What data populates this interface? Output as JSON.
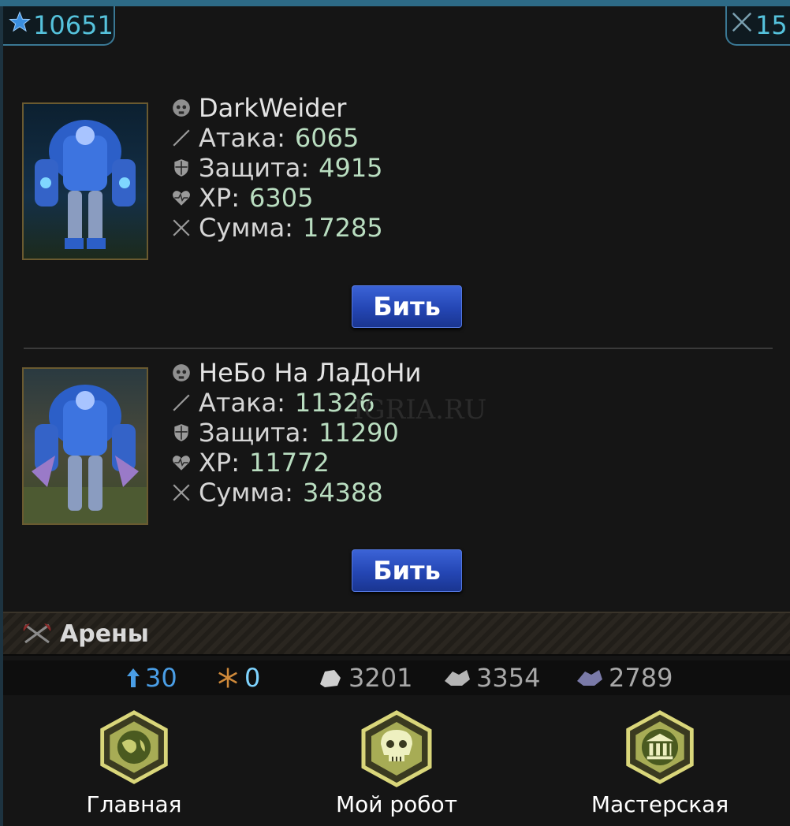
{
  "header": {
    "rating_value": "10651",
    "battles_value": "15"
  },
  "opponents": [
    {
      "name": "DarkWeider",
      "attack_label": "Атака:",
      "attack": "6065",
      "defense_label": "Защита:",
      "defense": "4915",
      "hp_label": "ХР:",
      "hp": "6305",
      "total_label": "Сумма:",
      "total": "17285",
      "button": "Бить"
    },
    {
      "name": "НеБо На ЛаДоНи",
      "attack_label": "Атака:",
      "attack": "11326",
      "defense_label": "Защита:",
      "defense": "11290",
      "hp_label": "ХР:",
      "hp": "11772",
      "total_label": "Сумма:",
      "total": "34388",
      "button": "Бить"
    }
  ],
  "watermark": "IGRIA.RU",
  "arena": {
    "title": "Арены"
  },
  "resources": {
    "level": "30",
    "snow": "0",
    "ore1": "3201",
    "ore2": "3354",
    "ore3": "2789"
  },
  "nav": [
    {
      "label": "Главная",
      "icon": "globe-icon"
    },
    {
      "label": "Мой робот",
      "icon": "skull-icon"
    },
    {
      "label": "Мастерская",
      "icon": "building-icon"
    }
  ],
  "colors": {
    "accent": "#55c2dc",
    "button": "#2446b4",
    "stat_value": "#b9ddc0"
  }
}
